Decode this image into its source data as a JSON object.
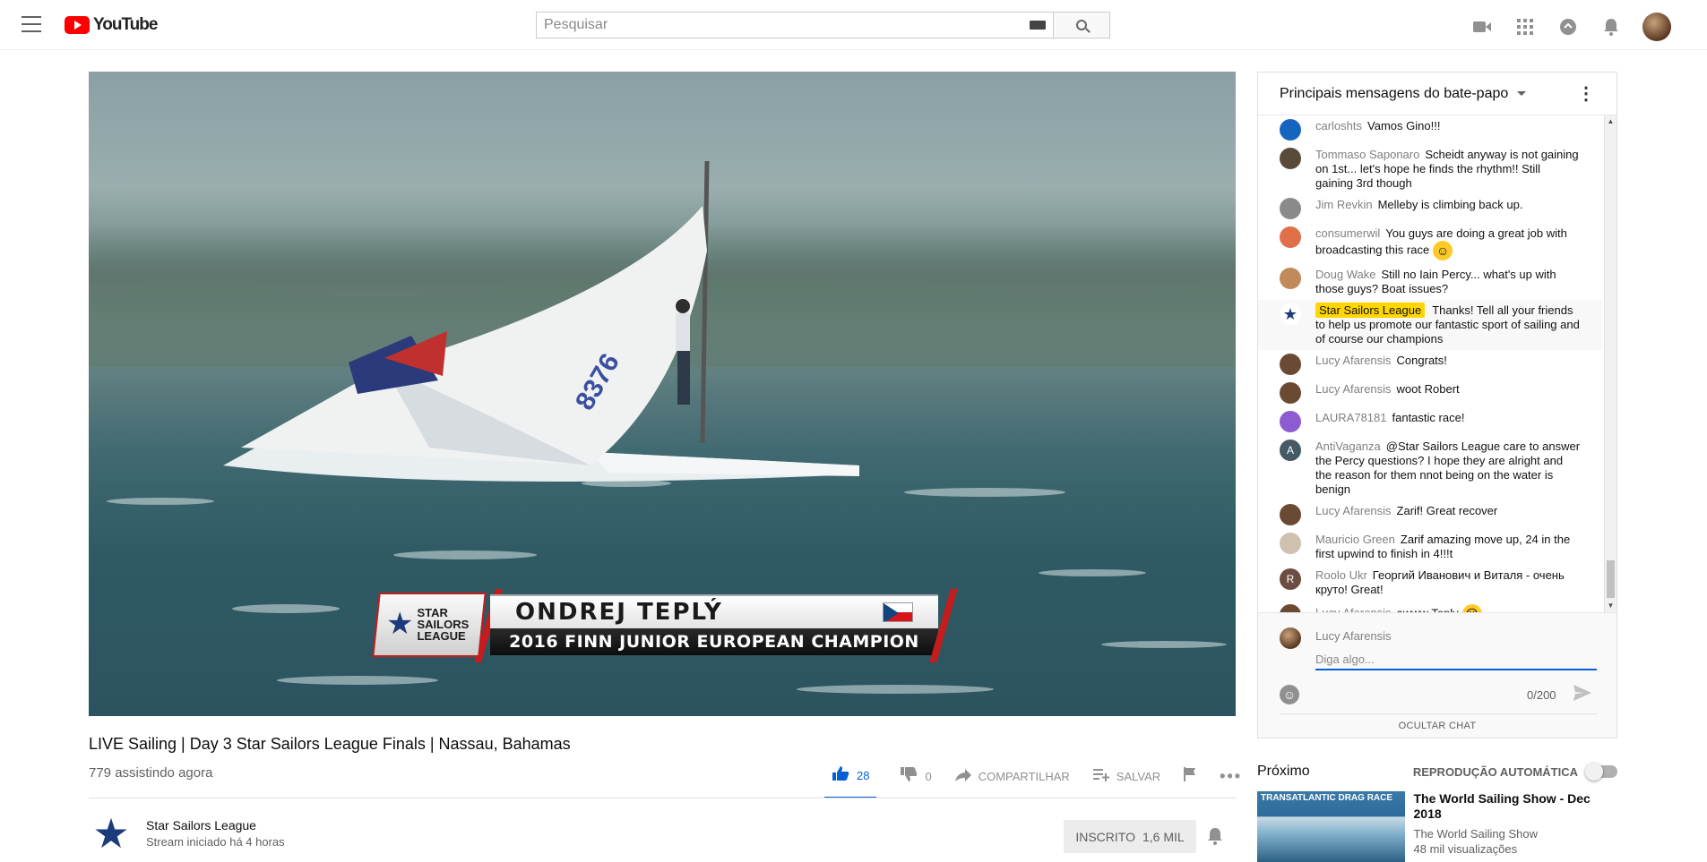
{
  "header": {
    "logo_text": "YouTube",
    "search_placeholder": "Pesquisar"
  },
  "video": {
    "overlay_logo": "STAR SAILORS LEAGUE",
    "overlay_name": "ONDREJ TEPLÝ",
    "overlay_title": "2016 FINN JUNIOR EUROPEAN CHAMPION",
    "sail_number": "8376",
    "title": "LIVE Sailing | Day 3 Star Sailors League Finals | Nassau, Bahamas",
    "viewers": "779 assistindo agora"
  },
  "actions": {
    "likes": "28",
    "dislikes": "0",
    "share": "COMPARTILHAR",
    "save": "SALVAR"
  },
  "channel": {
    "name": "Star Sailors League",
    "sub": "Stream iniciado há 4 horas",
    "subscribe": "INSCRITO",
    "subscribers": "1,6 MIL"
  },
  "chat": {
    "title": "Principais mensagens do bate-papo",
    "messages": [
      {
        "author": "carloshts",
        "text": "Vamos Gino!!!",
        "avatar": "#1565c0",
        "letter": "",
        "emoji": ""
      },
      {
        "author": "Tommaso Saponaro",
        "text": "Scheidt anyway is not gaining on 1st... let's hope he finds the rhythm!! Still gaining 3rd though",
        "avatar": "#5a4a3a",
        "letter": "",
        "emoji": ""
      },
      {
        "author": "Jim Revkin",
        "text": "Melleby is climbing back up.",
        "avatar": "#8a8a8a",
        "letter": "",
        "emoji": ""
      },
      {
        "author": "consumerwil",
        "text": "You guys are doing a great job with broadcasting this race",
        "avatar": "#e0704a",
        "letter": "",
        "emoji": "☺"
      },
      {
        "author": "Doug Wake",
        "text": "Still no Iain Percy... what's up with those guys? Boat issues?",
        "avatar": "#c08a5a",
        "letter": "",
        "emoji": ""
      },
      {
        "author": "Star Sailors League",
        "text": "Thanks! Tell all your friends to help us promote our fantastic sport of sailing and of course our champions",
        "avatar": "#ffffff",
        "letter": "★",
        "emoji": "",
        "owner": true
      },
      {
        "author": "Lucy Afarensis",
        "text": "Congrats!",
        "avatar": "#6b4a34",
        "letter": "",
        "emoji": ""
      },
      {
        "author": "Lucy Afarensis",
        "text": "woot Robert",
        "avatar": "#6b4a34",
        "letter": "",
        "emoji": ""
      },
      {
        "author": "LAURA78181",
        "text": "fantastic race!",
        "avatar": "#8e5bd0",
        "letter": "",
        "emoji": ""
      },
      {
        "author": "AntiVaganza",
        "text": "@Star Sailors League care to answer the Percy questions? I hope they are alright and the reason for them nnot being on the water is benign",
        "avatar": "#455a64",
        "letter": "A",
        "emoji": ""
      },
      {
        "author": "Lucy Afarensis",
        "text": "Zarif! Great recover",
        "avatar": "#6b4a34",
        "letter": "",
        "emoji": ""
      },
      {
        "author": "Mauricio Green",
        "text": "Zarif amazing move up, 24 in the first upwind to finish in 4!!!t",
        "avatar": "#d0c0b0",
        "letter": "",
        "emoji": ""
      },
      {
        "author": "Roolo Ukr",
        "text": "Георгий Иванович и Виталя - очень круто! Great!",
        "avatar": "#6d4c41",
        "letter": "R",
        "emoji": ""
      },
      {
        "author": "Lucy Afarensis",
        "text": "awww Teply",
        "avatar": "#6b4a34",
        "letter": "",
        "emoji": "☹"
      }
    ],
    "input_author": "Lucy Afarensis",
    "input_placeholder": "Diga algo...",
    "counter": "0/200",
    "hide_chat": "OCULTAR CHAT"
  },
  "upnext": {
    "title": "Próximo",
    "autoplay": "REPRODUÇÃO AUTOMÁTICA",
    "item_thumb_text": "TRANSATLANTIC DRAG RACE",
    "item_title": "The World Sailing Show - Dec 2018",
    "item_channel": "The World Sailing Show",
    "item_views": "48 mil visualizações"
  },
  "colors": {
    "accent": "#065fd4",
    "brand": "#ff0000",
    "owner_badge": "#ffd600"
  }
}
